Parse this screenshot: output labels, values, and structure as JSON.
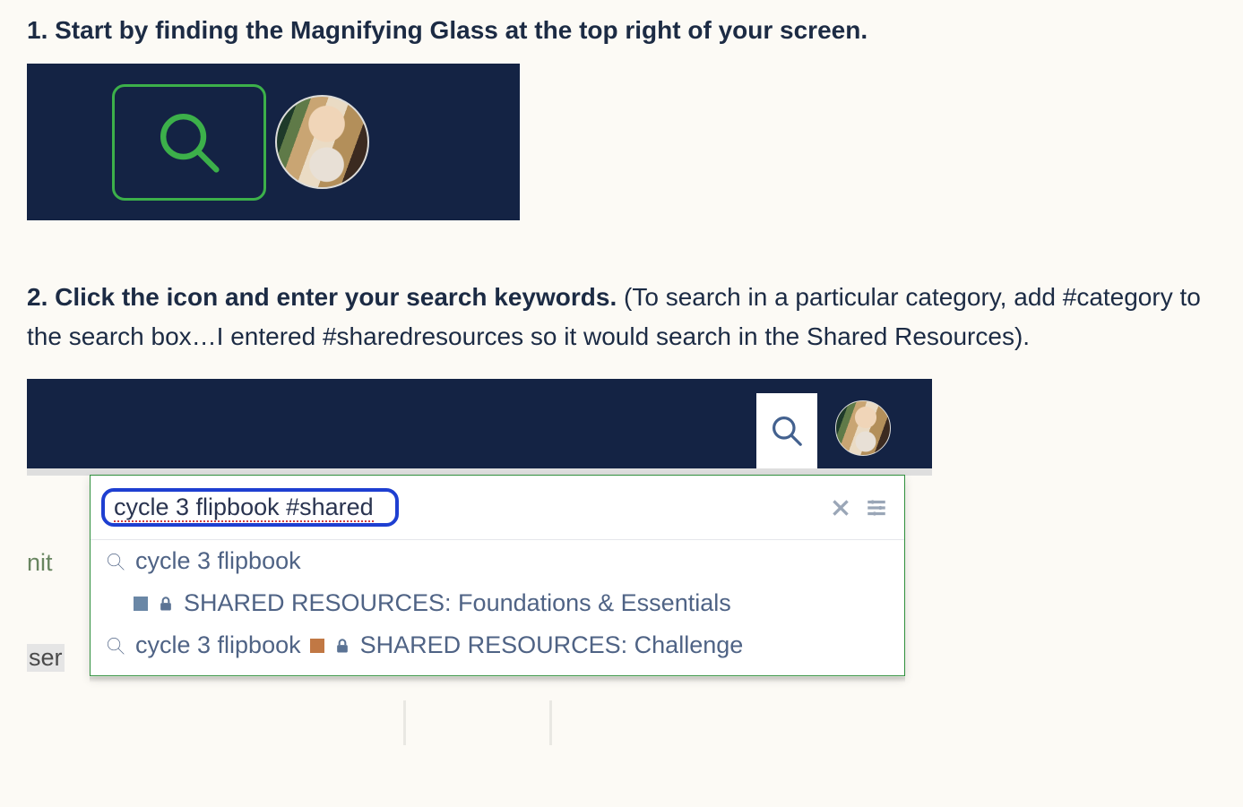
{
  "steps": {
    "s1_bold": "1. Start by finding the Magnifying Glass at the top right of your screen.",
    "s2_bold": "2. Click the icon and enter your search keywords.",
    "s2_rest": " (To search in a particular category, add #category to the search box…I entered #sharedresources so it would search in the Shared Resources)."
  },
  "search": {
    "query": "cycle 3 flipbook #shared",
    "results": [
      {
        "query_text": "cycle 3 flipbook",
        "category": "SHARED RESOURCES: Foundations & Essentials",
        "square_color": "blue",
        "layout": "stacked"
      },
      {
        "query_text": "cycle 3 flipbook",
        "category": "SHARED RESOURCES: Challenge",
        "square_color": "orange",
        "layout": "inline"
      }
    ]
  },
  "bg_fragments": {
    "left1": "nit",
    "left2": "ser"
  }
}
